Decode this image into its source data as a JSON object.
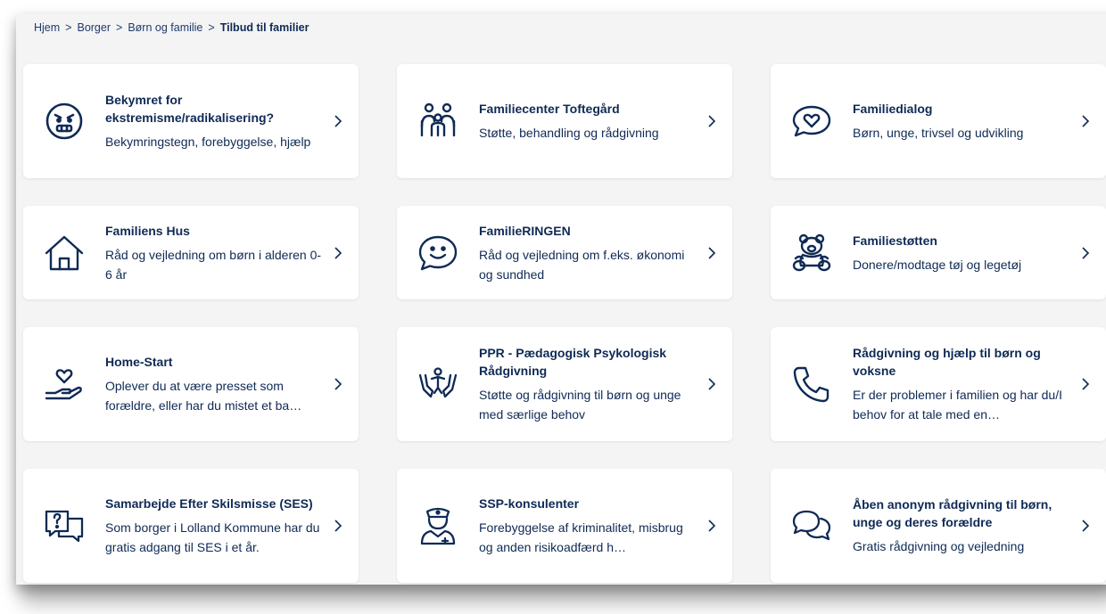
{
  "breadcrumb": {
    "items": [
      "Hjem",
      "Borger",
      "Børn og familie"
    ],
    "separator": ">",
    "current": "Tilbud til familier"
  },
  "cards": [
    {
      "title": "Bekymret for ekstremisme/radikalisering?",
      "desc": "Bekymringstegn, forebyggelse, hjælp",
      "icon": "angry-face-icon"
    },
    {
      "title": "Familiecenter Toftegård",
      "desc": "Støtte, behandling og rådgivning",
      "icon": "family-icon"
    },
    {
      "title": "Familiedialog",
      "desc": "Børn, unge, trivsel og udvikling",
      "icon": "heart-speech-bubble-icon"
    },
    {
      "title": "Familiens Hus",
      "desc": "Råd og vejledning om børn i alderen 0-6 år",
      "icon": "house-icon"
    },
    {
      "title": "FamilieRINGEN",
      "desc": "Råd og vejledning om f.eks. økonomi og sundhed",
      "icon": "smile-speech-bubble-icon"
    },
    {
      "title": "Familiestøtten",
      "desc": "Donere/modtage tøj og legetøj",
      "icon": "teddy-bear-icon"
    },
    {
      "title": "Home-Start",
      "desc": "Oplever du at være presset som forældre, eller har du mistet et ba…",
      "icon": "heart-hand-icon"
    },
    {
      "title": "PPR - Pædagogisk Psykologisk Rådgivning",
      "desc": "Støtte og rådgivning til børn og unge med særlige behov",
      "icon": "child-hands-icon"
    },
    {
      "title": "Rådgivning og hjælp til børn og voksne",
      "desc": "Er der problemer i familien og har du/I behov for at tale med en…",
      "icon": "phone-icon"
    },
    {
      "title": "Samarbejde Efter Skilsmisse (SES)",
      "desc": "Som borger i Lolland Kommune har du gratis adgang til SES i et år.",
      "icon": "question-chat-icon"
    },
    {
      "title": "SSP-konsulenter",
      "desc": "Forebyggelse af kriminalitet, misbrug og anden risikoadfærd h…",
      "icon": "police-officer-icon"
    },
    {
      "title": "Åben anonym rådgivning til børn, unge og deres forældre",
      "desc": "Gratis rådgivning og vejledning",
      "icon": "chat-bubbles-icon"
    }
  ],
  "colors": {
    "text": "#0f2a55",
    "background": "#f4f4f4",
    "card": "#ffffff"
  }
}
